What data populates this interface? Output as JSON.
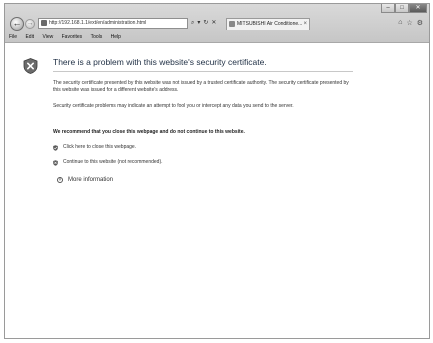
{
  "browser": {
    "address": "http://192.168.1.1/ext/en/administration.html",
    "address_tools": [
      "⌕",
      "▾",
      "↻",
      "✕"
    ],
    "tab_title": "MITSUBISHI Air Conditione...",
    "tab_close": "×",
    "toolbar_icons": [
      "⌂",
      "☆",
      "⚙"
    ],
    "window_controls": [
      "–",
      "□",
      "✕"
    ],
    "back_symbol": "←",
    "forward_symbol": "→",
    "menu": [
      "File",
      "Edit",
      "View",
      "Favorites",
      "Tools",
      "Help"
    ]
  },
  "page": {
    "title": "There is a problem with this website's security certificate.",
    "paragraph1": "The security certificate presented by this website was not issued by a trusted certificate authority. The security certificate presented by this website was issued for a different website's address.",
    "paragraph2": "Security certificate problems may indicate an attempt to fool you or intercept any data you send to the server.",
    "recommendation": "We recommend that you close this webpage and do not continue to this website.",
    "close_link": "Click here to close this webpage.",
    "continue_link": "Continue to this website (not recommended).",
    "more_info": "More information",
    "more_info_symbol": "˅"
  },
  "colors": {
    "title": "#1f2f44",
    "chrome": "#d0d0d0"
  }
}
